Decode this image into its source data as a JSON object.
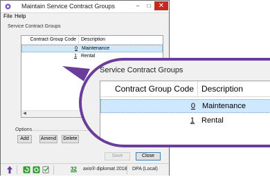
{
  "window": {
    "title": "Maintain Service Contract Groups",
    "controls": {
      "minimize": "–",
      "maximize": "□",
      "close": "✕"
    }
  },
  "menu": {
    "file": "File",
    "help": "Help"
  },
  "contract_groups": {
    "label": "Service Contract Groups",
    "columns": {
      "code": "Contract Group Code",
      "description": "Description"
    },
    "rows": [
      {
        "code": "0",
        "description": "Maintenance",
        "selected": true
      },
      {
        "code": "1",
        "description": "Rental",
        "selected": false
      }
    ]
  },
  "options": {
    "label": "Options",
    "add": "Add",
    "amend": "Amend",
    "delete": "Delete"
  },
  "actions": {
    "save": "Save",
    "close": "Close"
  },
  "status": {
    "count": "32",
    "product": "axis® diplomat 2018",
    "environment": "DPA (Local)"
  },
  "zoom": {
    "label": "Service Contract Groups",
    "columns": {
      "code": "Contract Group Code",
      "description": "Description"
    },
    "rows": [
      {
        "code": "0",
        "description": "Maintenance"
      },
      {
        "code": "1",
        "description": "Rental"
      }
    ]
  },
  "colors": {
    "callout": "#6a3d9a",
    "selection": "#cde8ff",
    "close_button": "#c42b1c"
  },
  "icons": [
    "app-gear-icon",
    "home-arrow-icon",
    "refresh-green-icon",
    "sync-icon",
    "checklist-icon",
    "chevron-left-icon",
    "chevron-right-icon"
  ]
}
